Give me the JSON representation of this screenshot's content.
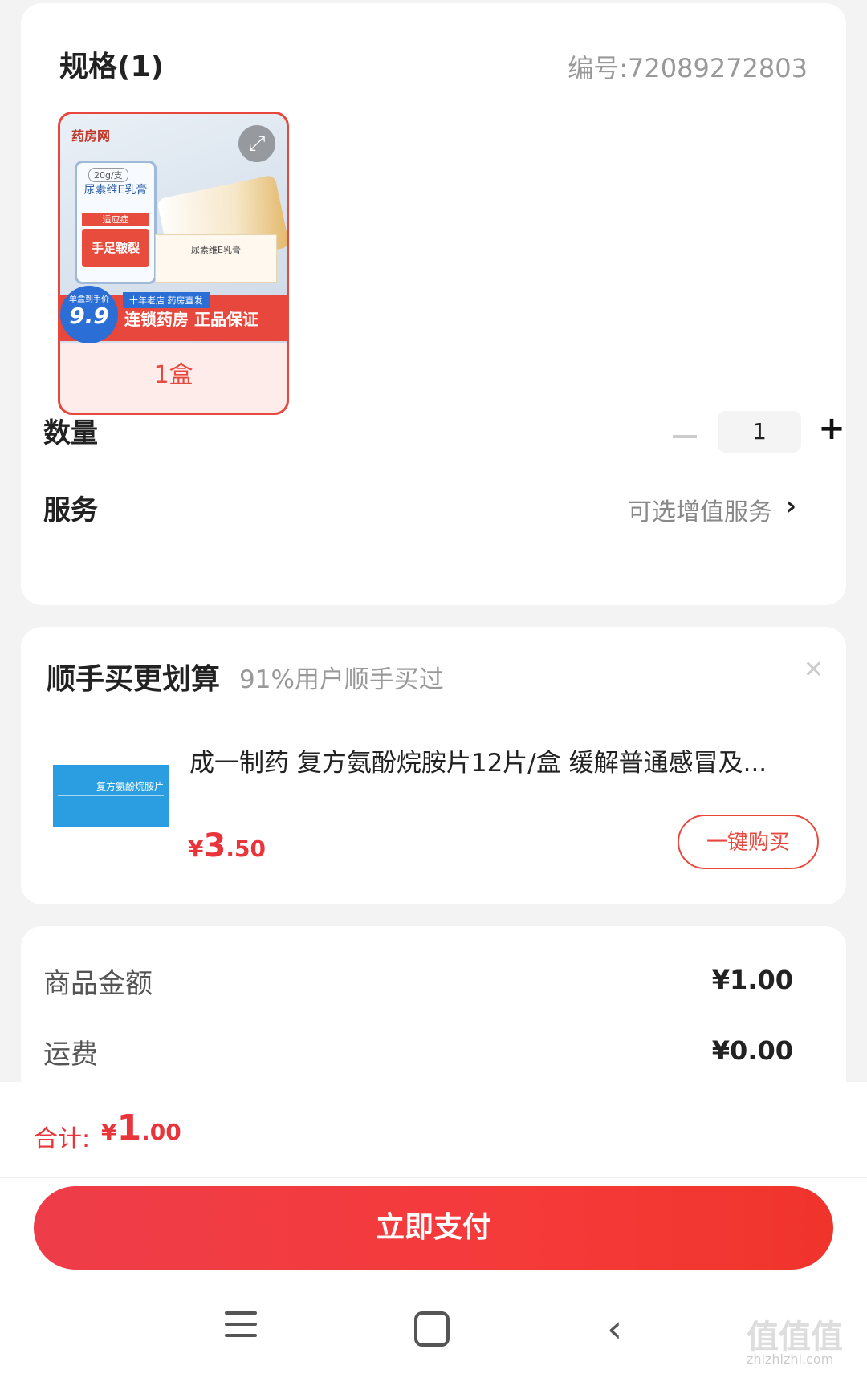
{
  "spec": {
    "title": "规格(1)",
    "code": "编号:72089272803",
    "sku": {
      "label": "1盒",
      "brand": "药房网",
      "box_spec": "20g/支",
      "box_name": "尿素维E乳膏",
      "indication": "适应症",
      "indication_value": "手足皲裂",
      "carton_text": "尿素维E乳膏",
      "price_tag": "单盒到手价",
      "price_value": "9.9",
      "strip": "十年老店 药房直发",
      "slogan": "连锁药房 正品保证"
    },
    "quantity_label": "数量",
    "quantity_value": "1",
    "service_label": "服务",
    "service_value": "可选增值服务"
  },
  "upsell": {
    "title": "顺手买更划算",
    "subtitle": "91%用户顺手买过",
    "product_name": "成一制药 复方氨酚烷胺片12片/盒 缓解普通感冒及...",
    "thumb_title": "复方氨酚烷胺片",
    "price_currency": "¥",
    "price_int": "3",
    "price_dec": ".50",
    "buy_label": "一键购买"
  },
  "summary": {
    "items": [
      {
        "label": "商品金额",
        "value": "¥1.00"
      },
      {
        "label": "运费",
        "value": "¥0.00"
      }
    ]
  },
  "bottom": {
    "total_label": "合计:",
    "total_currency": "¥",
    "total_int": "1",
    "total_dec": ".00",
    "pay_label": "立即支付"
  },
  "watermark": {
    "text": "值值值",
    "url_text": "zhizhizhi.com"
  },
  "colors": {
    "accent": "#e8473d",
    "price": "#e8343a"
  }
}
